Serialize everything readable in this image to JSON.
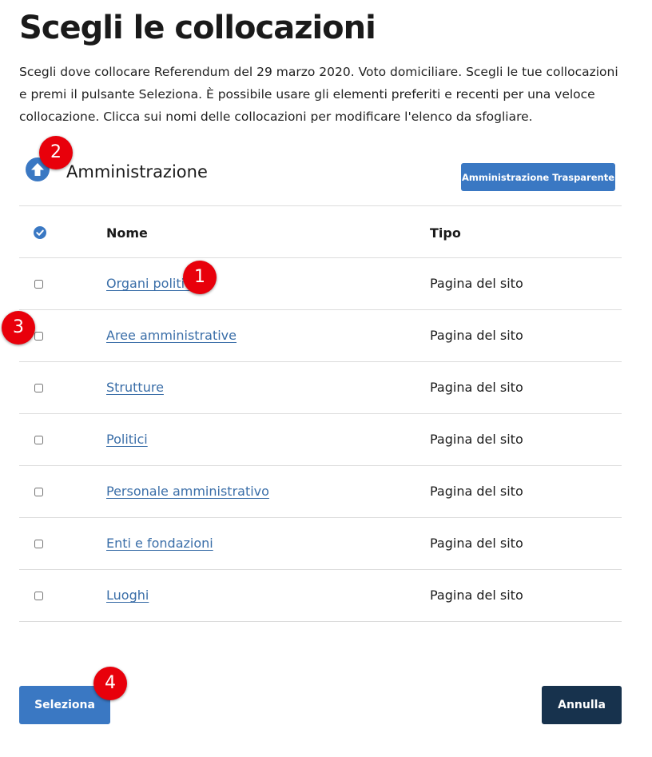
{
  "page": {
    "title": "Scegli le collocazioni",
    "description": "Scegli dove collocare Referendum del 29 marzo 2020. Voto domiciliare. Scegli le tue collocazioni e premi il pulsante Seleziona. È possibile usare gli elementi preferiti e recenti per una veloce collocazione. Clicca sui nomi delle collocazioni per modificare l'elenco da sfogliare."
  },
  "browser": {
    "current_folder": "Amministrazione",
    "shortcut_button": "Amministrazione Trasparente"
  },
  "table": {
    "headers": {
      "name": "Nome",
      "type": "Tipo"
    },
    "rows": [
      {
        "name": "Organi politici",
        "type": "Pagina del sito"
      },
      {
        "name": "Aree amministrative",
        "type": "Pagina del sito"
      },
      {
        "name": "Strutture",
        "type": "Pagina del sito"
      },
      {
        "name": "Politici",
        "type": "Pagina del sito"
      },
      {
        "name": "Personale amministrativo",
        "type": "Pagina del sito"
      },
      {
        "name": "Enti e fondazioni",
        "type": "Pagina del sito"
      },
      {
        "name": "Luoghi",
        "type": "Pagina del sito"
      }
    ]
  },
  "actions": {
    "select": "Seleziona",
    "cancel": "Annulla"
  },
  "markers": [
    "1",
    "2",
    "3",
    "4"
  ],
  "colors": {
    "primary": "#3a78c3",
    "dark": "#17324d",
    "link": "#3a6ea8",
    "marker": "#e8000b"
  }
}
